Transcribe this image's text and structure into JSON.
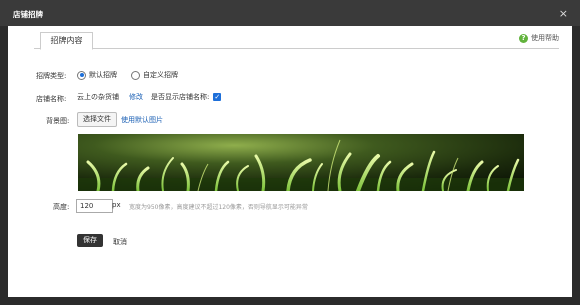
{
  "window": {
    "title": "店铺招牌",
    "close": "×"
  },
  "tab": {
    "label": "招牌内容"
  },
  "help": {
    "label": "使用帮助",
    "icon": "?"
  },
  "form": {
    "type_label": "招牌类型:",
    "type_options": [
      "默认招牌",
      "自定义招牌"
    ],
    "type_selected": "默认招牌",
    "name_label": "店铺名称:",
    "name_value": "云上の杂货铺",
    "name_edit": "修改",
    "show_name_label": "是否显示店铺名称:",
    "show_name_checked": true,
    "bg_label": "背景图:",
    "choose_file": "选择文件",
    "use_default": "使用默认图片",
    "height_label": "高度:",
    "height_value": "120",
    "height_unit": "px",
    "height_hint": "宽度为950像素，高度建议不超过120像素，否则导航显示可能异常"
  },
  "actions": {
    "save": "保存",
    "cancel": "取消"
  }
}
